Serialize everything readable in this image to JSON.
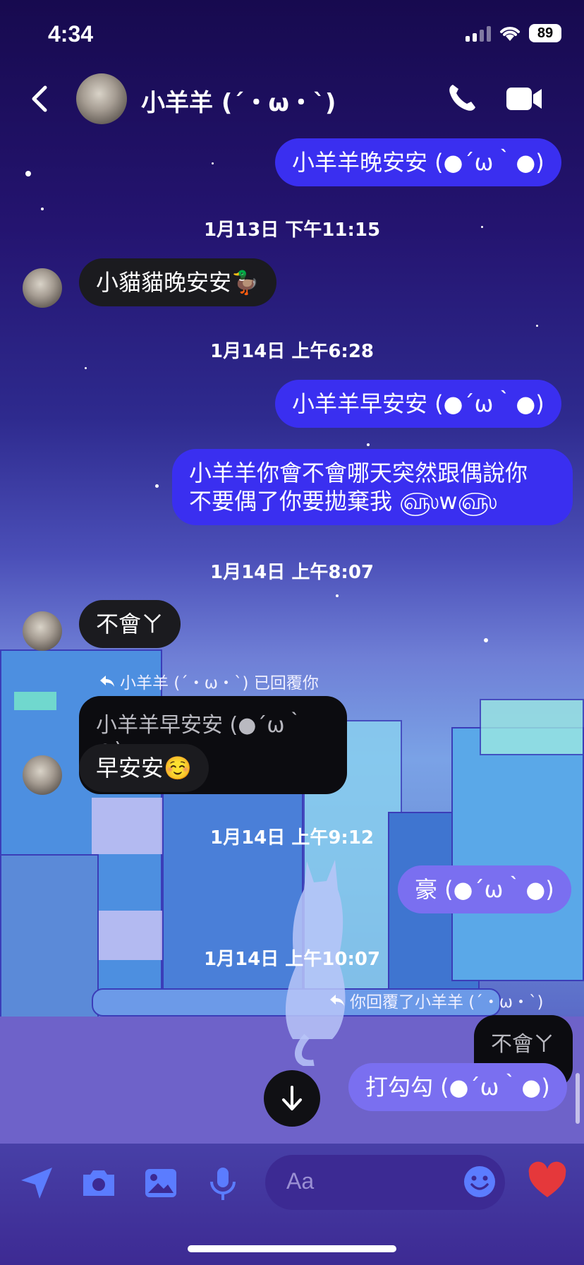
{
  "status": {
    "time": "4:34",
    "battery": "89"
  },
  "header": {
    "contact_name": "小羊羊 (´・ω・`)"
  },
  "messages": {
    "m1": "小羊羊晚安安 (●´ω｀●)",
    "ts1": "1月13日 下午11:15",
    "m2": "小貓貓晚安安🦆",
    "ts2": "1月14日 上午6:28",
    "m3": "小羊羊早安安 (●´ω｀●)",
    "m4_line1": "小羊羊你會不會哪天突然跟偶說你",
    "m4_line2": "不要偶了你要拋棄我 ௵w௵",
    "ts3": "1月14日 上午8:07",
    "m5": "不會ㄚ",
    "reply_note1": "小羊羊 (´・ω・`) 已回覆你",
    "quoted1": "小羊羊早安安 (●´ω｀●)",
    "m6": "早安安☺️",
    "ts4": "1月14日 上午9:12",
    "m7": "豪 (●´ω｀●)",
    "ts5": "1月14日 上午10:07",
    "reply_note2": "你回覆了小羊羊 (´・ω・`)",
    "quoted2": "不會ㄚ",
    "m8": "打勾勾 (●´ω｀●)"
  },
  "composer": {
    "placeholder": "Aa"
  },
  "icons": {
    "back": "chevron-left-icon",
    "call": "phone-icon",
    "video": "video-camera-icon",
    "send_location": "location-arrow-icon",
    "camera": "camera-icon",
    "gallery": "image-icon",
    "mic": "microphone-icon",
    "emoji": "smiley-icon",
    "like": "heart-icon",
    "scroll_down": "arrow-down-icon"
  },
  "colors": {
    "outgoing": "#3a2ff0",
    "incoming": "#1b1b1f",
    "accent": "#e5383b"
  }
}
